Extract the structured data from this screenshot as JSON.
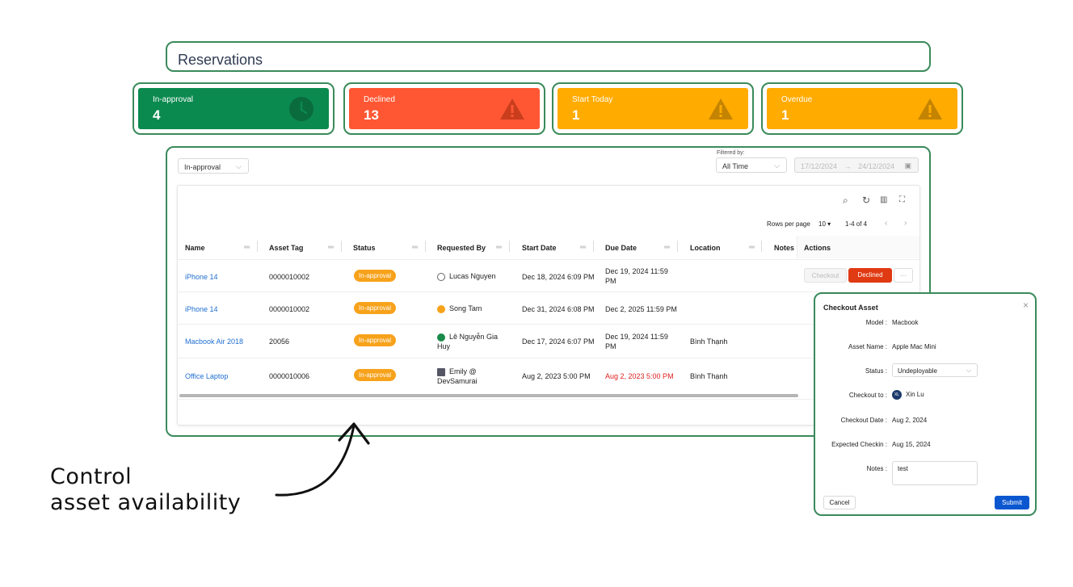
{
  "header": {
    "title": "Reservations"
  },
  "stats": [
    {
      "label": "In-approval",
      "value": "4",
      "color": "#0b8a4f",
      "icon": "clock-icon"
    },
    {
      "label": "Declined",
      "value": "13",
      "color": "#ff5733",
      "icon": "warning-icon"
    },
    {
      "label": "Start Today",
      "value": "1",
      "color": "#ffab00",
      "icon": "warning-icon"
    },
    {
      "label": "Overdue",
      "value": "1",
      "color": "#ffab00",
      "icon": "warning-icon"
    }
  ],
  "filters": {
    "status_select": "In-approval",
    "filtered_by_label": "Filtered by:",
    "time_select": "All Time",
    "date_from": "17/12/2024",
    "date_arrow": "→",
    "date_to": "24/12/2024"
  },
  "pagination": {
    "rows_per_page_label": "Rows per page",
    "rows_per_page": "10",
    "range": "1-4 of 4"
  },
  "table": {
    "columns": [
      "Name",
      "Asset Tag",
      "Status",
      "Requested By",
      "Start Date",
      "Due Date",
      "Location",
      "Notes",
      "Actions"
    ],
    "rows": [
      {
        "name": "iPhone 14",
        "tag": "0000010002",
        "status": "In-approval",
        "by": "Lucas Nguyen",
        "start": "Dec 18, 2024 6:09 PM",
        "due": "Dec 19, 2024 11:59 PM",
        "location": ""
      },
      {
        "name": "iPhone 14",
        "tag": "0000010002",
        "status": "In-approval",
        "by": "Song Tam",
        "start": "Dec 31, 2024 6:08 PM",
        "due": "Dec 2, 2025 11:59 PM",
        "location": ""
      },
      {
        "name": "Macbook Air 2018",
        "tag": "20056",
        "status": "In-approval",
        "by": "Lê Nguyễn Gia Huy",
        "start": "Dec 17, 2024 6:07 PM",
        "due": "Dec 19, 2024 11:59 PM",
        "location": "Bình Thạnh"
      },
      {
        "name": "Office Laptop",
        "tag": "0000010006",
        "status": "In-approval",
        "by": "Emily @ DevSamurai",
        "start": "Aug 2, 2023 5:00 PM",
        "due": "Aug 2, 2023 5:00 PM",
        "location": "Bình Thạnh"
      }
    ],
    "actions": {
      "checkout": "Checkout",
      "declined": "Declined",
      "more": "···"
    }
  },
  "modal": {
    "title": "Checkout Asset",
    "fields": [
      {
        "label": "Model :",
        "value": "Macbook"
      },
      {
        "label": "Asset Name :",
        "value": "Apple Mac Mini"
      },
      {
        "label": "Status :",
        "value": "Undeployable"
      },
      {
        "label": "Checkout to :",
        "value": "Xin Lu",
        "initials": "XL"
      },
      {
        "label": "Checkout Date :",
        "value": "Aug 2, 2024"
      },
      {
        "label": "Expected Checkin :",
        "value": "Aug 15, 2024"
      },
      {
        "label": "Notes :",
        "value": "test"
      }
    ],
    "cancel": "Cancel",
    "submit": "Submit"
  },
  "caption": {
    "line1": "Control",
    "line2": "asset availability"
  }
}
